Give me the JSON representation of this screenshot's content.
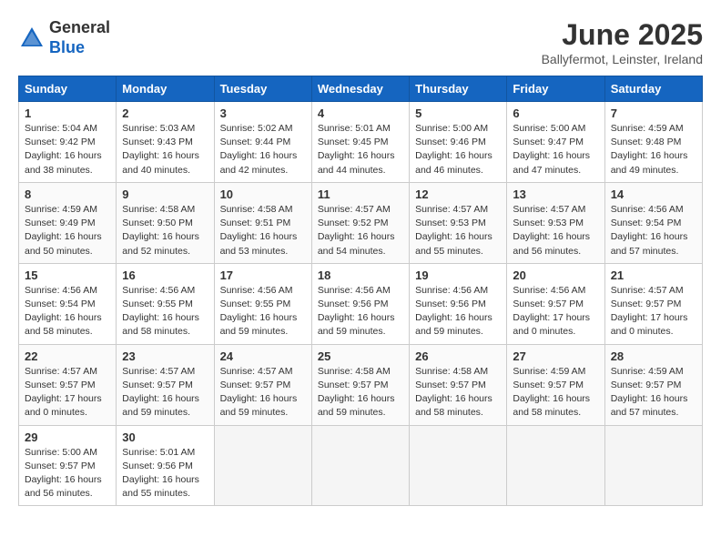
{
  "header": {
    "logo_line1": "General",
    "logo_line2": "Blue",
    "month_title": "June 2025",
    "subtitle": "Ballyfermot, Leinster, Ireland"
  },
  "days_of_week": [
    "Sunday",
    "Monday",
    "Tuesday",
    "Wednesday",
    "Thursday",
    "Friday",
    "Saturday"
  ],
  "weeks": [
    [
      {
        "day": "1",
        "sunrise": "5:04 AM",
        "sunset": "9:42 PM",
        "daylight": "16 hours and 38 minutes."
      },
      {
        "day": "2",
        "sunrise": "5:03 AM",
        "sunset": "9:43 PM",
        "daylight": "16 hours and 40 minutes."
      },
      {
        "day": "3",
        "sunrise": "5:02 AM",
        "sunset": "9:44 PM",
        "daylight": "16 hours and 42 minutes."
      },
      {
        "day": "4",
        "sunrise": "5:01 AM",
        "sunset": "9:45 PM",
        "daylight": "16 hours and 44 minutes."
      },
      {
        "day": "5",
        "sunrise": "5:00 AM",
        "sunset": "9:46 PM",
        "daylight": "16 hours and 46 minutes."
      },
      {
        "day": "6",
        "sunrise": "5:00 AM",
        "sunset": "9:47 PM",
        "daylight": "16 hours and 47 minutes."
      },
      {
        "day": "7",
        "sunrise": "4:59 AM",
        "sunset": "9:48 PM",
        "daylight": "16 hours and 49 minutes."
      }
    ],
    [
      {
        "day": "8",
        "sunrise": "4:59 AM",
        "sunset": "9:49 PM",
        "daylight": "16 hours and 50 minutes."
      },
      {
        "day": "9",
        "sunrise": "4:58 AM",
        "sunset": "9:50 PM",
        "daylight": "16 hours and 52 minutes."
      },
      {
        "day": "10",
        "sunrise": "4:58 AM",
        "sunset": "9:51 PM",
        "daylight": "16 hours and 53 minutes."
      },
      {
        "day": "11",
        "sunrise": "4:57 AM",
        "sunset": "9:52 PM",
        "daylight": "16 hours and 54 minutes."
      },
      {
        "day": "12",
        "sunrise": "4:57 AM",
        "sunset": "9:53 PM",
        "daylight": "16 hours and 55 minutes."
      },
      {
        "day": "13",
        "sunrise": "4:57 AM",
        "sunset": "9:53 PM",
        "daylight": "16 hours and 56 minutes."
      },
      {
        "day": "14",
        "sunrise": "4:56 AM",
        "sunset": "9:54 PM",
        "daylight": "16 hours and 57 minutes."
      }
    ],
    [
      {
        "day": "15",
        "sunrise": "4:56 AM",
        "sunset": "9:54 PM",
        "daylight": "16 hours and 58 minutes."
      },
      {
        "day": "16",
        "sunrise": "4:56 AM",
        "sunset": "9:55 PM",
        "daylight": "16 hours and 58 minutes."
      },
      {
        "day": "17",
        "sunrise": "4:56 AM",
        "sunset": "9:55 PM",
        "daylight": "16 hours and 59 minutes."
      },
      {
        "day": "18",
        "sunrise": "4:56 AM",
        "sunset": "9:56 PM",
        "daylight": "16 hours and 59 minutes."
      },
      {
        "day": "19",
        "sunrise": "4:56 AM",
        "sunset": "9:56 PM",
        "daylight": "16 hours and 59 minutes."
      },
      {
        "day": "20",
        "sunrise": "4:56 AM",
        "sunset": "9:57 PM",
        "daylight": "17 hours and 0 minutes."
      },
      {
        "day": "21",
        "sunrise": "4:57 AM",
        "sunset": "9:57 PM",
        "daylight": "17 hours and 0 minutes."
      }
    ],
    [
      {
        "day": "22",
        "sunrise": "4:57 AM",
        "sunset": "9:57 PM",
        "daylight": "17 hours and 0 minutes."
      },
      {
        "day": "23",
        "sunrise": "4:57 AM",
        "sunset": "9:57 PM",
        "daylight": "16 hours and 59 minutes."
      },
      {
        "day": "24",
        "sunrise": "4:57 AM",
        "sunset": "9:57 PM",
        "daylight": "16 hours and 59 minutes."
      },
      {
        "day": "25",
        "sunrise": "4:58 AM",
        "sunset": "9:57 PM",
        "daylight": "16 hours and 59 minutes."
      },
      {
        "day": "26",
        "sunrise": "4:58 AM",
        "sunset": "9:57 PM",
        "daylight": "16 hours and 58 minutes."
      },
      {
        "day": "27",
        "sunrise": "4:59 AM",
        "sunset": "9:57 PM",
        "daylight": "16 hours and 58 minutes."
      },
      {
        "day": "28",
        "sunrise": "4:59 AM",
        "sunset": "9:57 PM",
        "daylight": "16 hours and 57 minutes."
      }
    ],
    [
      {
        "day": "29",
        "sunrise": "5:00 AM",
        "sunset": "9:57 PM",
        "daylight": "16 hours and 56 minutes."
      },
      {
        "day": "30",
        "sunrise": "5:01 AM",
        "sunset": "9:56 PM",
        "daylight": "16 hours and 55 minutes."
      },
      null,
      null,
      null,
      null,
      null
    ]
  ]
}
